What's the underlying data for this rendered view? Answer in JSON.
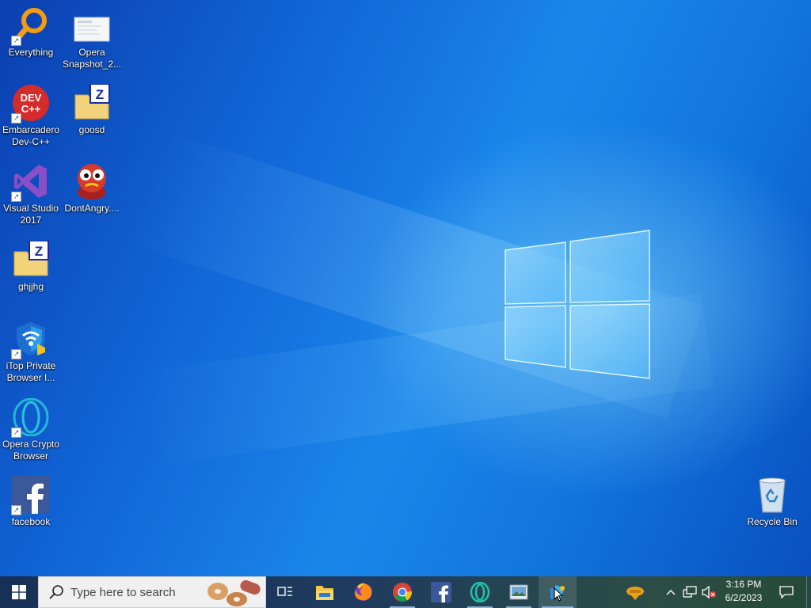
{
  "desktop": {
    "icons": [
      {
        "label": "Everything"
      },
      {
        "label": "Opera Snapshot_2..."
      },
      {
        "label": "Embarcadero Dev-C++"
      },
      {
        "label": "goosd"
      },
      {
        "label": "Visual Studio 2017"
      },
      {
        "label": "DontAngry...."
      },
      {
        "label": "ghjjhg"
      },
      {
        "label": "iTop Private Browser I..."
      },
      {
        "label": "Opera Crypto Browser"
      },
      {
        "label": "facebook"
      },
      {
        "label": "Recycle Bin"
      }
    ],
    "badges": {
      "devcpp": "DEV\nC++",
      "archive": "Z"
    }
  },
  "taskbar": {
    "search_placeholder": "Type here to search",
    "apps": [
      "task-view",
      "file-explorer",
      "firefox",
      "chrome",
      "facebook",
      "opera",
      "photo-viewer",
      "app-active"
    ],
    "clock": {
      "time": "3:16 PM",
      "date": "6/2/2023"
    }
  },
  "colors": {
    "accent": "#0078d7",
    "taskbar": "#1f3b5e",
    "desktop": "#1174e0"
  }
}
